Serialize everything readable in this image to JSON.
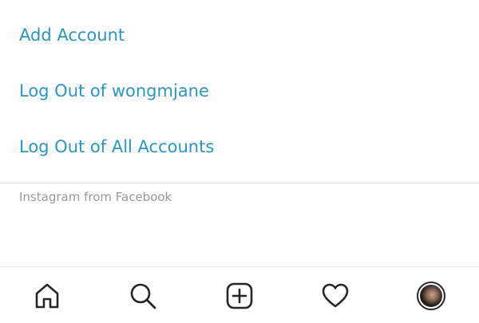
{
  "menu": {
    "items": [
      {
        "label": "Add Account"
      },
      {
        "label": "Log Out of wongmjane"
      },
      {
        "label": "Log Out of All Accounts"
      }
    ],
    "accent_color": "#2a96c6"
  },
  "footer": {
    "note": "Instagram from Facebook"
  },
  "bottom_nav": {
    "items": [
      {
        "icon": "home-icon"
      },
      {
        "icon": "search-icon"
      },
      {
        "icon": "new-post-icon"
      },
      {
        "icon": "heart-icon"
      },
      {
        "icon": "profile-avatar"
      }
    ]
  }
}
